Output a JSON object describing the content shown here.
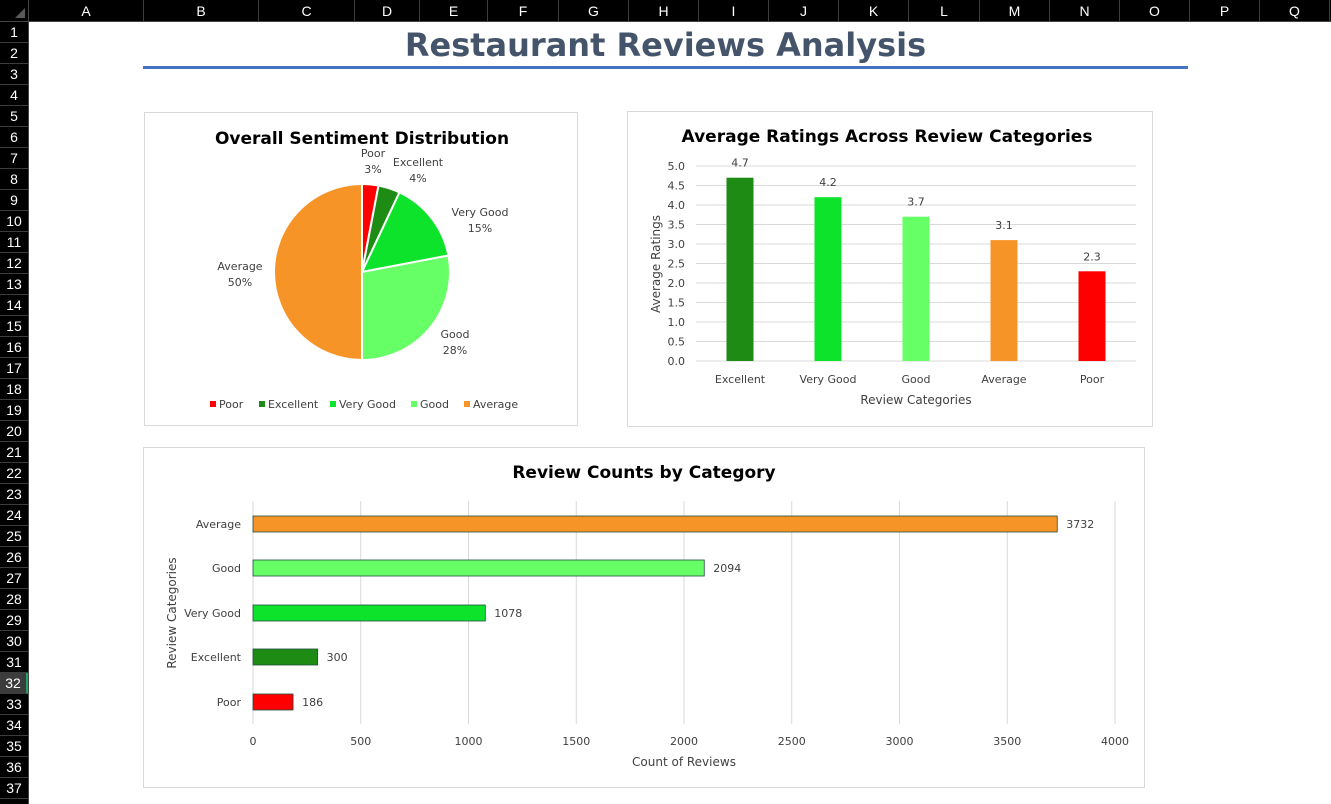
{
  "sheet": {
    "columns": [
      "A",
      "B",
      "C",
      "D",
      "E",
      "F",
      "G",
      "H",
      "I",
      "J",
      "K",
      "L",
      "M",
      "N",
      "O",
      "P",
      "Q"
    ],
    "rows": [
      "1",
      "2",
      "3",
      "4",
      "5",
      "6",
      "7",
      "8",
      "9",
      "10",
      "11",
      "12",
      "13",
      "14",
      "15",
      "16",
      "17",
      "18",
      "19",
      "20",
      "21",
      "22",
      "23",
      "24",
      "25",
      "26",
      "27",
      "28",
      "29",
      "30",
      "31",
      "32",
      "33",
      "34",
      "35",
      "36",
      "37"
    ],
    "selected_row": "32"
  },
  "dashboard": {
    "title": "Restaurant Reviews Analysis"
  },
  "colors": {
    "Poor": "#ff0000",
    "Excellent": "#1e8c14",
    "Very Good": "#0ce32a",
    "Good": "#66ff66",
    "Average": "#f79428",
    "accent": "#4472c4",
    "title": "#44546a"
  },
  "chart_data": [
    {
      "type": "pie",
      "title": "Overall Sentiment Distribution",
      "categories": [
        "Poor",
        "Excellent",
        "Very Good",
        "Good",
        "Average"
      ],
      "values": [
        3,
        4,
        15,
        28,
        50
      ],
      "labels": [
        "3%",
        "4%",
        "15%",
        "28%",
        "50%"
      ],
      "legend": [
        "Poor",
        "Excellent",
        "Very Good",
        "Good",
        "Average"
      ],
      "legend_position": "bottom"
    },
    {
      "type": "bar",
      "title": "Average Ratings Across Review Categories",
      "categories": [
        "Excellent",
        "Very Good",
        "Good",
        "Average",
        "Poor"
      ],
      "values": [
        4.7,
        4.2,
        3.7,
        3.1,
        2.3
      ],
      "value_labels": [
        "4.7",
        "4.2",
        "3.7",
        "3.1",
        "2.3"
      ],
      "xlabel": "Review Categories",
      "ylabel": "Average Ratings",
      "ylim": [
        0,
        5
      ],
      "yticks": [
        "0.0",
        "0.5",
        "1.0",
        "1.5",
        "2.0",
        "2.5",
        "3.0",
        "3.5",
        "4.0",
        "4.5",
        "5.0"
      ],
      "grid": true
    },
    {
      "type": "bar",
      "orientation": "horizontal",
      "title": "Review Counts by Category",
      "categories": [
        "Average",
        "Good",
        "Very Good",
        "Excellent",
        "Poor"
      ],
      "values": [
        3732,
        2094,
        1078,
        300,
        186
      ],
      "value_labels": [
        "3732",
        "2094",
        "1078",
        "300",
        "186"
      ],
      "xlabel": "Count of Reviews",
      "ylabel": "Review Categories",
      "xlim": [
        0,
        4000
      ],
      "xticks": [
        "0",
        "500",
        "1000",
        "1500",
        "2000",
        "2500",
        "3000",
        "3500",
        "4000"
      ],
      "grid": true
    }
  ]
}
